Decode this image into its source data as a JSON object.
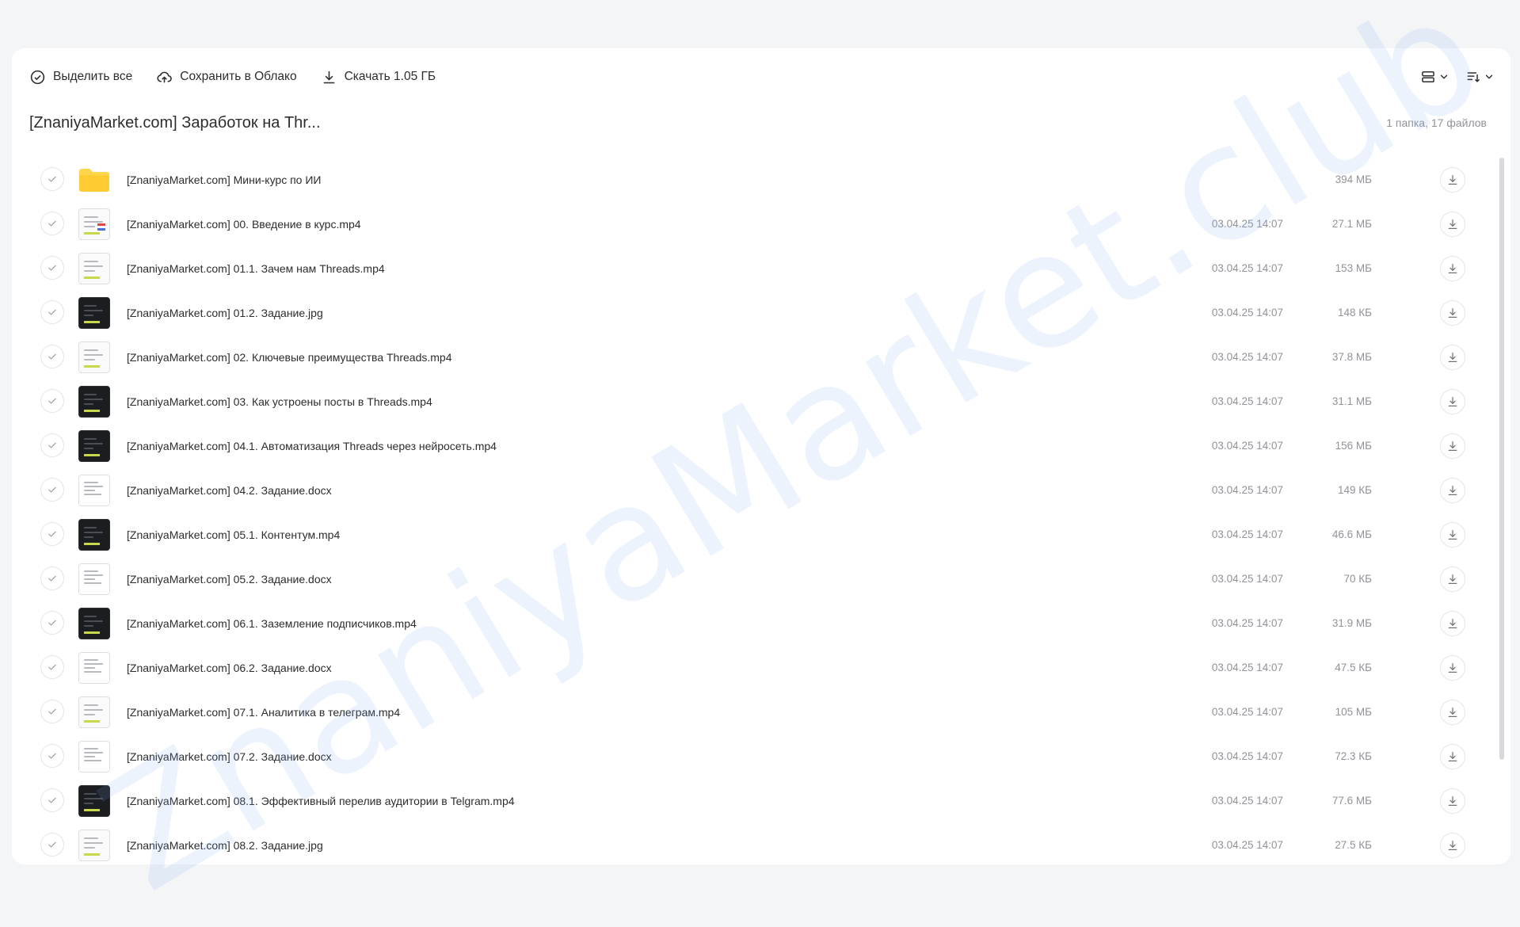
{
  "toolbar": {
    "select_all": "Выделить все",
    "save_to_cloud": "Сохранить в Облако",
    "download": "Скачать 1.05 ГБ"
  },
  "folder": {
    "title": "[ZnaniyaMarket.com] Заработок на Thr...",
    "count": "1 папка, 17 файлов"
  },
  "watermark": "ZnaniyaMarket.club",
  "colors": {
    "accent_folder": "#ffd54d",
    "text_primary": "#2c2d2e",
    "text_secondary": "#919399"
  },
  "files": [
    {
      "name": "[ZnaniyaMarket.com] Мини-курс по ИИ",
      "date": "",
      "size": "394 МБ",
      "thumb": "folder"
    },
    {
      "name": "[ZnaniyaMarket.com] 00. Введение в курс.mp4",
      "date": "03.04.25 14:07",
      "size": "27.1 МБ",
      "thumb": "light-accent"
    },
    {
      "name": "[ZnaniyaMarket.com] 01.1. Зачем нам Threads.mp4",
      "date": "03.04.25 14:07",
      "size": "153 МБ",
      "thumb": "light"
    },
    {
      "name": "[ZnaniyaMarket.com] 01.2. Задание.jpg",
      "date": "03.04.25 14:07",
      "size": "148 КБ",
      "thumb": "dark"
    },
    {
      "name": "[ZnaniyaMarket.com] 02. Ключевые преимущества Threads.mp4",
      "date": "03.04.25 14:07",
      "size": "37.8 МБ",
      "thumb": "light"
    },
    {
      "name": "[ZnaniyaMarket.com] 03. Как устроены посты в Threads.mp4",
      "date": "03.04.25 14:07",
      "size": "31.1 МБ",
      "thumb": "dark"
    },
    {
      "name": "[ZnaniyaMarket.com] 04.1. Автоматизация Threads через нейросеть.mp4",
      "date": "03.04.25 14:07",
      "size": "156 МБ",
      "thumb": "dark"
    },
    {
      "name": "[ZnaniyaMarket.com] 04.2. Задание.docx",
      "date": "03.04.25 14:07",
      "size": "149 КБ",
      "thumb": "doc"
    },
    {
      "name": "[ZnaniyaMarket.com] 05.1. Контентум.mp4",
      "date": "03.04.25 14:07",
      "size": "46.6 МБ",
      "thumb": "dark"
    },
    {
      "name": "[ZnaniyaMarket.com] 05.2. Задание.docx",
      "date": "03.04.25 14:07",
      "size": "70 КБ",
      "thumb": "doc"
    },
    {
      "name": "[ZnaniyaMarket.com] 06.1. Заземление подписчиков.mp4",
      "date": "03.04.25 14:07",
      "size": "31.9 МБ",
      "thumb": "dark"
    },
    {
      "name": "[ZnaniyaMarket.com] 06.2. Задание.docx",
      "date": "03.04.25 14:07",
      "size": "47.5 КБ",
      "thumb": "doc"
    },
    {
      "name": "[ZnaniyaMarket.com] 07.1. Аналитика в телеграм.mp4",
      "date": "03.04.25 14:07",
      "size": "105 МБ",
      "thumb": "light"
    },
    {
      "name": "[ZnaniyaMarket.com] 07.2. Задание.docx",
      "date": "03.04.25 14:07",
      "size": "72.3 КБ",
      "thumb": "doc"
    },
    {
      "name": "[ZnaniyaMarket.com] 08.1. Эффективный перелив аудитории в Telgram.mp4",
      "date": "03.04.25 14:07",
      "size": "77.6 МБ",
      "thumb": "dark"
    },
    {
      "name": "[ZnaniyaMarket.com] 08.2. Задание.jpg",
      "date": "03.04.25 14:07",
      "size": "27.5 КБ",
      "thumb": "light"
    }
  ]
}
